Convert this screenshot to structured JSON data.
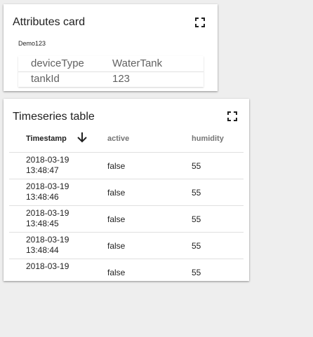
{
  "attributes_card": {
    "title": "Attributes card",
    "entity": "Demo123",
    "rows": [
      {
        "key": "deviceType",
        "value": "WaterTank"
      },
      {
        "key": "tankId",
        "value": "123"
      }
    ]
  },
  "timeseries_card": {
    "title": "Timeseries table",
    "columns": {
      "timestamp": "Timestamp",
      "active": "active",
      "humidity": "humidity"
    },
    "sort": "descending",
    "rows": [
      {
        "date": "2018-03-19",
        "time": "13:48:47",
        "active": "false",
        "humidity": "55"
      },
      {
        "date": "2018-03-19",
        "time": "13:48:46",
        "active": "false",
        "humidity": "55"
      },
      {
        "date": "2018-03-19",
        "time": "13:48:45",
        "active": "false",
        "humidity": "55"
      },
      {
        "date": "2018-03-19",
        "time": "13:48:44",
        "active": "false",
        "humidity": "55"
      },
      {
        "date": "2018-03-19",
        "time": "",
        "active": "false",
        "humidity": "55"
      }
    ]
  },
  "icons": {
    "fullscreen": "fullscreen-icon",
    "sort": "arrow-down-icon"
  },
  "colors": {
    "background": "#eeeeee",
    "card": "#ffffff",
    "text": "#212121",
    "muted": "#757575",
    "divider": "#e0e0e0"
  }
}
